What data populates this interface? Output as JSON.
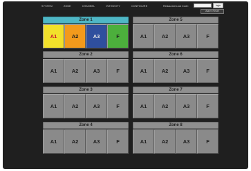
{
  "colors": {
    "background": "#1f1f1f",
    "tile": "#8a8a8a",
    "active_header": "#4fb7c6",
    "a1_active": "#f2e12b",
    "a2_active": "#f39a1c",
    "a3_active": "#2f4f9e",
    "f_active": "#4caf3c"
  },
  "nav": {
    "items": [
      "SYSTEM",
      "ZONE",
      "CHANNEL",
      "INTENSITY",
      "CONFIGURE"
    ]
  },
  "auth": {
    "lock_label": "Restaurant Lock Code:",
    "lock_value": "",
    "login_label": "login",
    "alarm_reset_label": "Alarm Reset"
  },
  "zones": [
    {
      "name": "Zone 1",
      "active": true,
      "buttons": [
        "A1",
        "A2",
        "A3",
        "F"
      ]
    },
    {
      "name": "Zone 2",
      "active": false,
      "buttons": [
        "A1",
        "A2",
        "A3",
        "F"
      ]
    },
    {
      "name": "Zone 3",
      "active": false,
      "buttons": [
        "A1",
        "A2",
        "A3",
        "F"
      ]
    },
    {
      "name": "Zone 4",
      "active": false,
      "buttons": [
        "A1",
        "A2",
        "A3",
        "F"
      ]
    },
    {
      "name": "Zone 5",
      "active": false,
      "buttons": [
        "A1",
        "A2",
        "A3",
        "F"
      ]
    },
    {
      "name": "Zone 6",
      "active": false,
      "buttons": [
        "A1",
        "A2",
        "A3",
        "F"
      ]
    },
    {
      "name": "Zone 7",
      "active": false,
      "buttons": [
        "A1",
        "A2",
        "A3",
        "F"
      ]
    },
    {
      "name": "Zone 8",
      "active": false,
      "buttons": [
        "A1",
        "A2",
        "A3",
        "F"
      ]
    }
  ]
}
